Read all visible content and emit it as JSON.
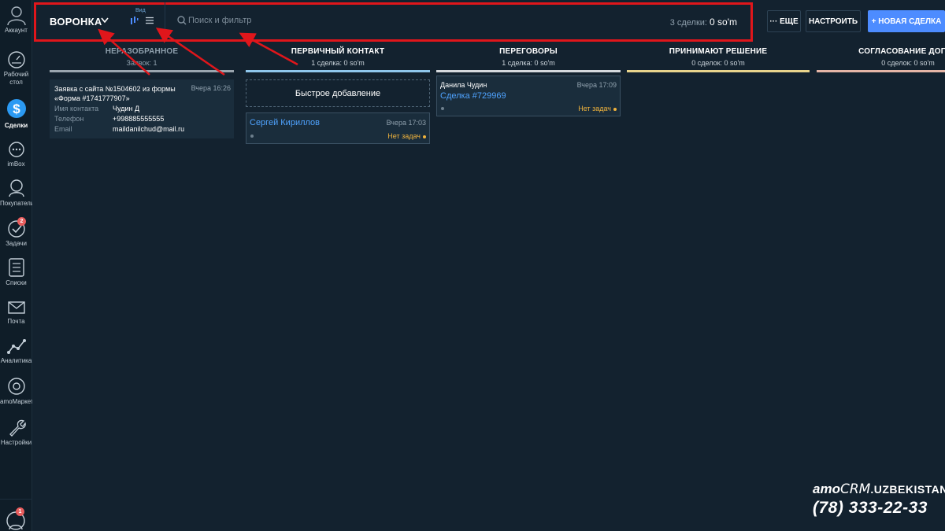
{
  "sidebar": {
    "account": {
      "label": "Аккаунт"
    },
    "items": [
      {
        "label": "Рабочий стол",
        "label2": "стол",
        "label1": "Рабочий"
      },
      {
        "label": "Сделки"
      },
      {
        "label": "imBox"
      },
      {
        "label": "Покупатели"
      },
      {
        "label": "Задачи",
        "badge": "2"
      },
      {
        "label": "Списки"
      },
      {
        "label": "Почта"
      },
      {
        "label": "Аналитика"
      },
      {
        "label": "amoМаркет"
      },
      {
        "label": "Настройки"
      }
    ],
    "bottom_badge": "1"
  },
  "topbar": {
    "pipeline_name": "ВОРОНКА",
    "view_label": "Вид",
    "search_placeholder": "Поиск и фильтр",
    "deal_count": "3 сделки:",
    "deal_sum": "0 so'm",
    "more_label": "··· ЕЩЕ",
    "setup_label": "НАСТРОИТЬ",
    "new_deal_label": "+ НОВАЯ СДЕЛКА"
  },
  "columns": [
    {
      "title": "НЕРАЗОБРАННОЕ",
      "subtitle": "Заявок: 1",
      "color": "#9aa5ae"
    },
    {
      "title": "ПЕРВИЧНЫЙ КОНТАКТ",
      "subtitle": "1 сделка: 0 so'm",
      "color": "#8fc7ec",
      "quick_add": "Быстрое добавление"
    },
    {
      "title": "ПЕРЕГОВОРЫ",
      "subtitle": "1 сделка: 0 so'm",
      "color": "#d5d9dd"
    },
    {
      "title": "ПРИНИМАЮТ РЕШЕНИЕ",
      "subtitle": "0 сделок: 0 so'm",
      "color": "#e8d48c"
    },
    {
      "title": "СОГЛАСОВАНИЕ ДОГОВ",
      "subtitle": "0 сделок: 0 so'm",
      "color": "#e5b5a6"
    }
  ],
  "lead_card": {
    "title": "Заявка с сайта №1504602 из формы «Форма #1741777907»",
    "time": "Вчера 16:26",
    "fields": [
      {
        "label": "Имя контакта",
        "value": "Чудин Д"
      },
      {
        "label": "Телефон",
        "value": "+998885555555"
      },
      {
        "label": "Email",
        "value": "maildanilchud@mail.ru"
      }
    ]
  },
  "deal_card_1": {
    "name": "Сергей Кириллов",
    "time": "Вчера 17:03",
    "status": "Нет задач"
  },
  "deal_card_2": {
    "contact": "Данила Чудин",
    "name": "Сделка #729969",
    "time": "Вчера 17:09",
    "status": "Нет задач"
  },
  "watermark": {
    "brand_a": "amo",
    "brand_b": "CRM",
    "brand_c": ".UZBEKISTAN",
    "phone": "(78) 333-22-33"
  },
  "colors": {
    "highlight_red": "#e0161b",
    "accent_blue": "#4d8cff",
    "link_blue": "#4fa3ff",
    "status_orange": "#f0b33c"
  }
}
